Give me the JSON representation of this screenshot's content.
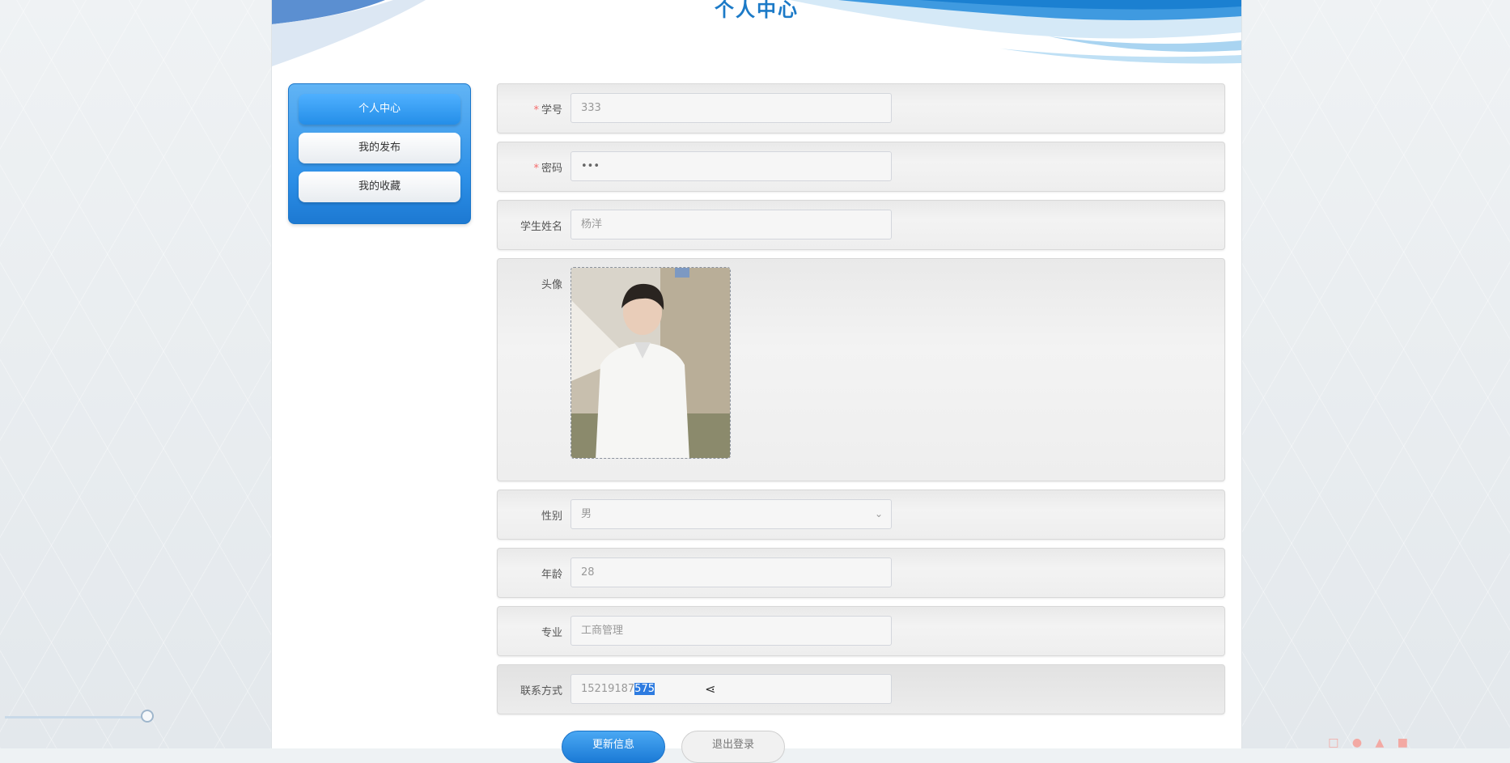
{
  "page": {
    "title": "个人中心"
  },
  "sidebar": {
    "items": [
      {
        "label": "个人中心",
        "active": true
      },
      {
        "label": "我的发布",
        "active": false
      },
      {
        "label": "我的收藏",
        "active": false
      }
    ]
  },
  "form": {
    "student_no": {
      "label": "学号",
      "required": true,
      "value": "333"
    },
    "password": {
      "label": "密码",
      "required": true,
      "value": "•••"
    },
    "student_name": {
      "label": "学生姓名",
      "value": "杨洋"
    },
    "avatar": {
      "label": "头像"
    },
    "gender": {
      "label": "性别",
      "value": "男"
    },
    "age": {
      "label": "年龄",
      "value": "28"
    },
    "major": {
      "label": "专业",
      "value": "工商管理"
    },
    "contact": {
      "label": "联系方式",
      "value_plain": "15219187",
      "value_selected": "575"
    }
  },
  "buttons": {
    "update": "更新信息",
    "logout": "退出登录"
  },
  "icons": {
    "select_arrow": "chevron-down-icon",
    "text_cursor": "i-beam-cursor-icon"
  },
  "colors": {
    "accent": "#1c7ac7",
    "sidebar_blue": "#2b8ee6",
    "required": "#f56c6c",
    "selection": "#2d7be0"
  }
}
